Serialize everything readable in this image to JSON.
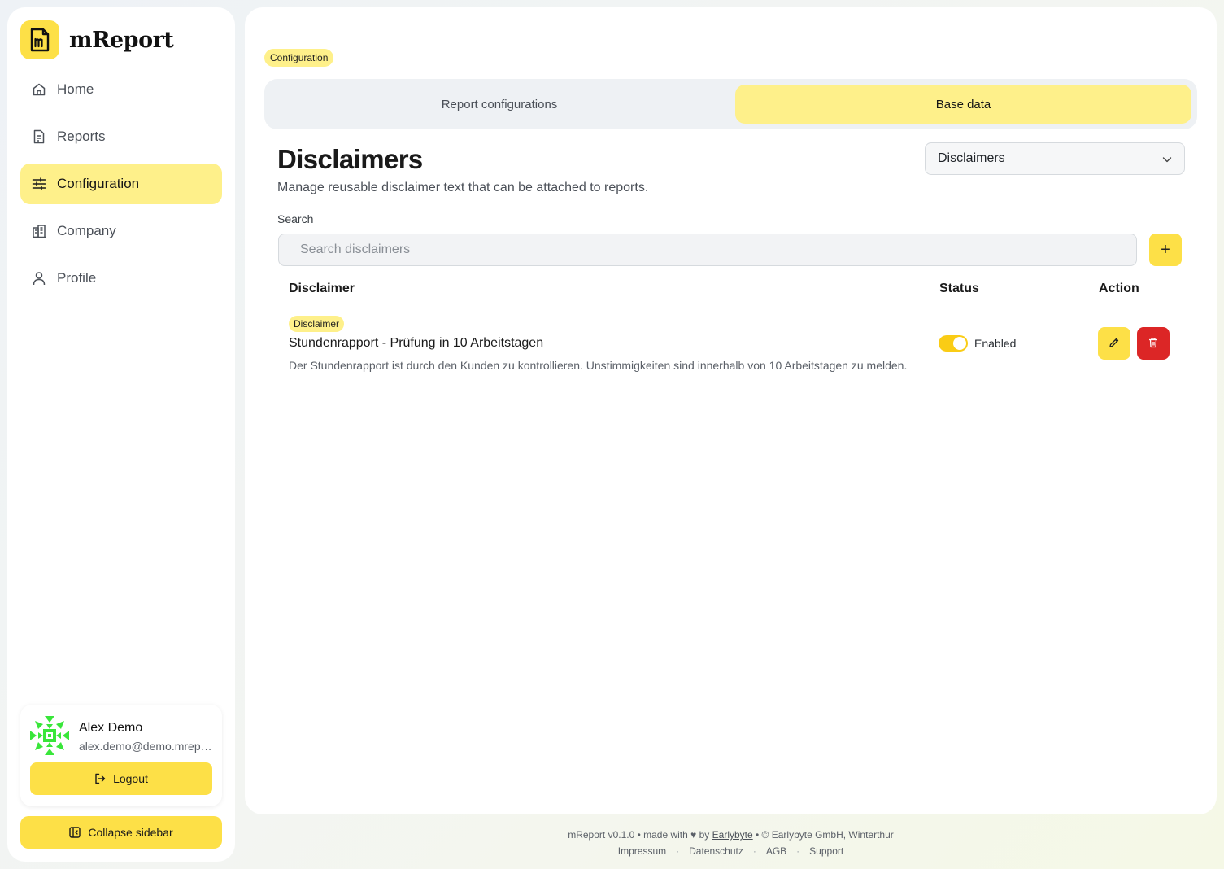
{
  "app": {
    "name": "mReport"
  },
  "sidebar": {
    "items": [
      {
        "label": "Home",
        "icon": "home-icon"
      },
      {
        "label": "Reports",
        "icon": "report-icon"
      },
      {
        "label": "Configuration",
        "icon": "sliders-icon"
      },
      {
        "label": "Company",
        "icon": "building-icon"
      },
      {
        "label": "Profile",
        "icon": "user-icon"
      }
    ],
    "active": "Configuration",
    "user": {
      "name": "Alex Demo",
      "email": "alex.demo@demo.mreport.ch"
    },
    "logout_label": "Logout",
    "collapse_label": "Collapse sidebar"
  },
  "main": {
    "breadcrumb": "Configuration",
    "tabs": [
      {
        "label": "Report configurations",
        "active": false
      },
      {
        "label": "Base data",
        "active": true
      }
    ],
    "title": "Disclaimers",
    "subtitle": "Manage reusable disclaimer text that can be attached to reports.",
    "select_value": "Disclaimers",
    "search": {
      "label": "Search",
      "placeholder": "Search disclaimers",
      "value": ""
    },
    "add_label": "+",
    "table": {
      "headers": {
        "disclaimer": "Disclaimer",
        "status": "Status",
        "action": "Action"
      },
      "rows": [
        {
          "badge": "Disclaimer",
          "title": "Stundenrapport - Prüfung in 10 Arbeitstagen",
          "text": "Der Stundenrapport ist durch den Kunden zu kontrollieren. Unstimmigkeiten sind innerhalb von 10 Arbeitstagen zu melden.",
          "status": "Enabled",
          "enabled": true
        }
      ]
    }
  },
  "footer": {
    "line1_prefix": "mReport v0.1.0 • made with ♥ by",
    "line1_link": "Earlybyte",
    "line1_suffix": "• © Earlybyte GmbH, Winterthur",
    "links": [
      "Impressum",
      "Datenschutz",
      "AGB",
      "Support"
    ]
  },
  "colors": {
    "accent": "#fde047",
    "accent_light": "#fef08a",
    "danger": "#dc2626",
    "avatar_green": "#39e63a"
  }
}
